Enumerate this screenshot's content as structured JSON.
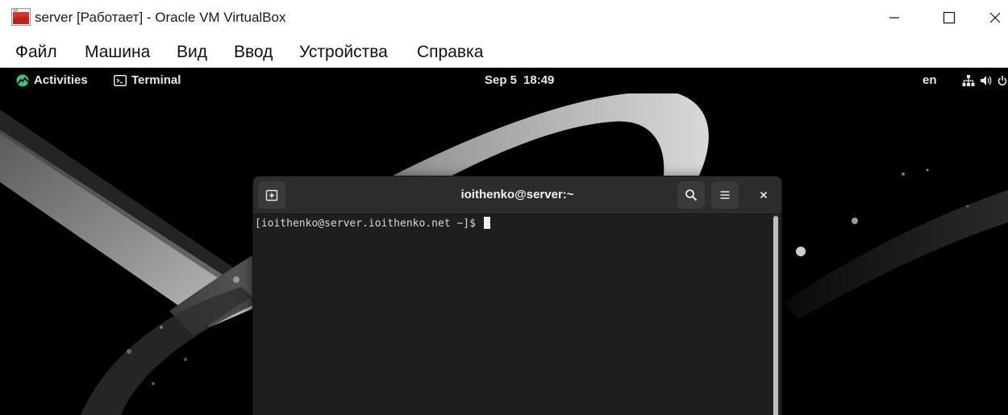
{
  "window": {
    "title": "server [Работает] - Oracle VM VirtualBox",
    "controls": {
      "minimize": "—",
      "maximize": "☐",
      "close": "×"
    }
  },
  "menu": {
    "items": [
      "Файл",
      "Машина",
      "Вид",
      "Ввод",
      "Устройства",
      "Справка"
    ]
  },
  "guest_topbar": {
    "activities": "Activities",
    "app_name": "Terminal",
    "date": "Sep 5",
    "time": "18:49",
    "language": "en"
  },
  "terminal": {
    "title": "ioithenko@server:~",
    "prompt": "[ioithenko@server.ioithenko.net ~]$ "
  },
  "colors": {
    "desktop_bg": "#000000",
    "terminal_bg": "#1e1e1e",
    "headerbar": "#2c2c2c",
    "accent_green": "#3fbf7f"
  }
}
